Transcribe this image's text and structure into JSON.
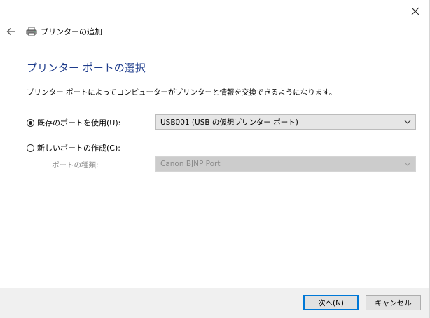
{
  "window": {
    "title": "プリンターの追加"
  },
  "page": {
    "heading": "プリンター ポートの選択",
    "description": "プリンター ポートによってコンピューターがプリンターと情報を交換できるようになります。"
  },
  "options": {
    "existing_port": {
      "label": "既存のポートを使用(U):",
      "selected": true,
      "value": "USB001 (USB の仮想プリンター ポート)"
    },
    "new_port": {
      "label": "新しいポートの作成(C):",
      "selected": false,
      "port_type_label": "ポートの種類:",
      "value": "Canon BJNP Port"
    }
  },
  "footer": {
    "next_label": "次へ(N)",
    "cancel_label": "キャンセル"
  },
  "icons": {
    "close": "close-icon",
    "back": "back-arrow-icon",
    "printer": "printer-icon",
    "dropdown": "chevron-down-icon"
  },
  "colors": {
    "heading": "#1e3c8c",
    "primary_border": "#0078d7",
    "footer_bg": "#f0f0f0"
  }
}
